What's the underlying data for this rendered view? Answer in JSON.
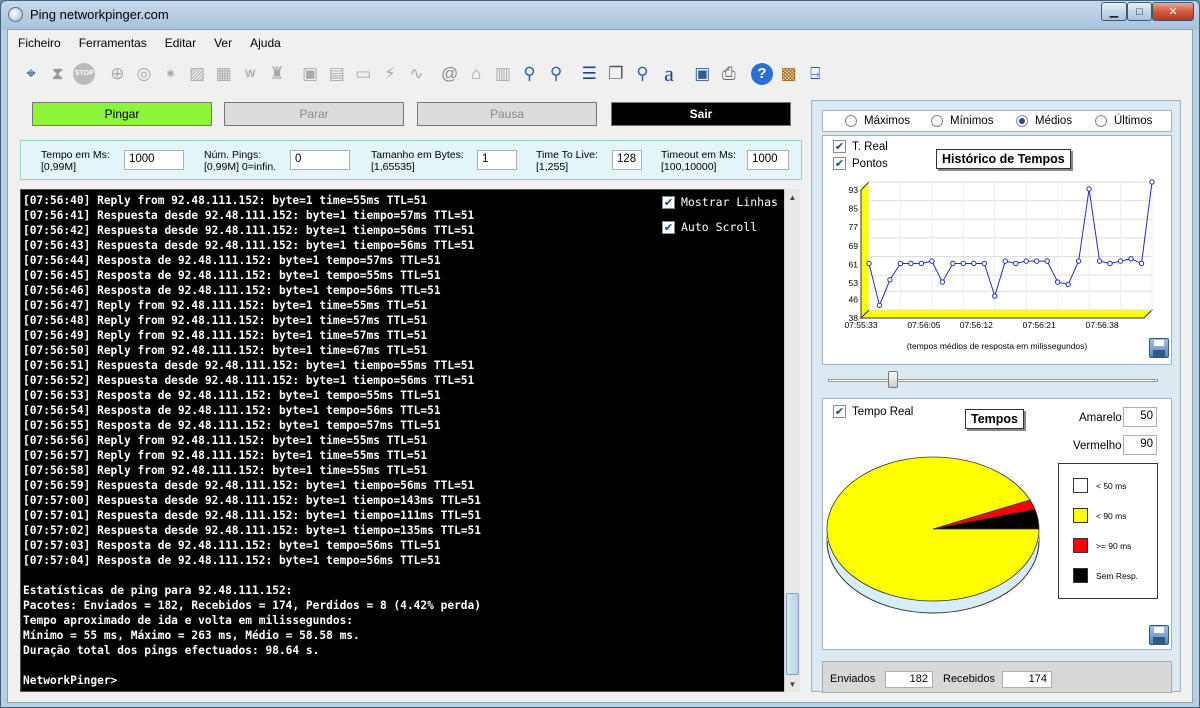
{
  "window": {
    "title": "Ping networkpinger.com",
    "minimize": "▁",
    "maximize": "□",
    "close": "✕"
  },
  "menu": [
    "Ficheiro",
    "Ferramentas",
    "Editar",
    "Ver",
    "Ajuda"
  ],
  "toolbar_icons": [
    "crosshair-icon",
    "hourglass-icon",
    "stop-icon",
    "target-icon",
    "magnifier-icon",
    "whois-icon",
    "traceroute-icon",
    "grid-icon",
    "wmi-icon",
    "castle-icon",
    "computers-icon",
    "monitor-scan-icon",
    "monitor-icon",
    "plug-icon",
    "cable-icon",
    "at-icon",
    "bank-icon",
    "printer-net-icon",
    "search-key-icon",
    "search-key2-icon",
    "list-icon",
    "copy-icon",
    "search-key3-icon",
    "font-icon",
    "save-icon",
    "print-icon",
    "help-icon",
    "treasure-icon",
    "exit-door-icon"
  ],
  "buttons": {
    "ping": "Pingar",
    "stop": "Parar",
    "pause": "Pausa",
    "exit": "Sair"
  },
  "params": {
    "tempo_label": "Tempo em Ms:",
    "tempo_range": "[0,99M]",
    "tempo_value": "1000",
    "num_label": "Núm. Pings:",
    "num_range": "[0,99M] 0=infin.",
    "num_value": "0",
    "size_label": "Tamanho em Bytes:",
    "size_range": "[1,65535]",
    "size_value": "1",
    "ttl_label": "Time To Live:",
    "ttl_range": "[1,255]",
    "ttl_value": "128",
    "timeout_label": "Timeout em Ms:",
    "timeout_range": "[100,10000]",
    "timeout_value": "1000"
  },
  "console": {
    "lines": [
      "[07:56:40] Reply from 92.48.111.152: byte=1 time=55ms TTL=51",
      "[07:56:41] Respuesta desde 92.48.111.152: byte=1 tiempo=57ms TTL=51",
      "[07:56:42] Respuesta desde 92.48.111.152: byte=1 tiempo=56ms TTL=51",
      "[07:56:43] Respuesta desde 92.48.111.152: byte=1 tiempo=56ms TTL=51",
      "[07:56:44] Resposta de 92.48.111.152: byte=1 tempo=57ms TTL=51",
      "[07:56:45] Resposta de 92.48.111.152: byte=1 tempo=55ms TTL=51",
      "[07:56:46] Resposta de 92.48.111.152: byte=1 tempo=56ms TTL=51",
      "[07:56:47] Reply from 92.48.111.152: byte=1 time=55ms TTL=51",
      "[07:56:48] Reply from 92.48.111.152: byte=1 time=57ms TTL=51",
      "[07:56:49] Reply from 92.48.111.152: byte=1 time=57ms TTL=51",
      "[07:56:50] Reply from 92.48.111.152: byte=1 time=67ms TTL=51",
      "[07:56:51] Respuesta desde 92.48.111.152: byte=1 tiempo=55ms TTL=51",
      "[07:56:52] Respuesta desde 92.48.111.152: byte=1 tiempo=56ms TTL=51",
      "[07:56:53] Resposta de 92.48.111.152: byte=1 tempo=55ms TTL=51",
      "[07:56:54] Resposta de 92.48.111.152: byte=1 tempo=56ms TTL=51",
      "[07:56:55] Resposta de 92.48.111.152: byte=1 tempo=57ms TTL=51",
      "[07:56:56] Reply from 92.48.111.152: byte=1 time=55ms TTL=51",
      "[07:56:57] Reply from 92.48.111.152: byte=1 time=55ms TTL=51",
      "[07:56:58] Reply from 92.48.111.152: byte=1 time=55ms TTL=51",
      "[07:56:59] Respuesta desde 92.48.111.152: byte=1 tiempo=56ms TTL=51",
      "[07:57:00] Respuesta desde 92.48.111.152: byte=1 tiempo=143ms TTL=51",
      "[07:57:01] Respuesta desde 92.48.111.152: byte=1 tiempo=111ms TTL=51",
      "[07:57:02] Respuesta desde 92.48.111.152: byte=1 tiempo=135ms TTL=51",
      "[07:57:03] Resposta de 92.48.111.152: byte=1 tempo=56ms TTL=51",
      "[07:57:04] Resposta de 92.48.111.152: byte=1 tempo=56ms TTL=51",
      "",
      "Estatísticas de ping para 92.48.111.152:",
      "Pacotes: Enviados = 182, Recebidos = 174, Perdidos = 8 (4.42% perda)",
      "Tempo aproximado de ida e volta em milissegundos:",
      "Mínimo = 55 ms, Máximo = 263 ms, Médio = 58.58 ms.",
      "Duração total dos pings efectuados: 98.64 s.",
      "",
      "NetworkPinger>"
    ],
    "show_lines": "Mostrar Linhas",
    "auto_scroll": "Auto Scroll"
  },
  "stats_mode": {
    "options": [
      "Máximos",
      "Mínimos",
      "Médios",
      "Últimos"
    ],
    "selected": "Médios"
  },
  "history": {
    "title": "Histórico de Tempos",
    "t_real": "T. Real",
    "pontos": "Pontos",
    "caption": "(tempos médios de resposta em milissegundos)",
    "y_ticks": [
      "93",
      "85",
      "77",
      "69",
      "61",
      "53",
      "46",
      "38"
    ],
    "x_ticks": [
      "07:55:33",
      "07:56:05",
      "07:56:12",
      "07:56:21",
      "07:56:38"
    ]
  },
  "chart_data": [
    {
      "type": "line",
      "title": "Histórico de Tempos",
      "xlabel": "(tempos médios de resposta em milissegundos)",
      "ylim": [
        38,
        93
      ],
      "x_tick_labels": [
        "07:55:33",
        "07:56:05",
        "07:56:12",
        "07:56:21",
        "07:56:38"
      ],
      "values": [
        58,
        40,
        51,
        58,
        58,
        58,
        59,
        50,
        58,
        58,
        58,
        58,
        44,
        59,
        58,
        59,
        59,
        59,
        50,
        49,
        59,
        90,
        59,
        58,
        59,
        60,
        58,
        94
      ],
      "color": "#1f2fbf"
    },
    {
      "type": "pie",
      "title": "Tempos",
      "labels": [
        "< 50 ms",
        "< 90 ms",
        ">= 90 ms",
        "Sem Resp."
      ],
      "values": [
        0,
        93.4,
        2.2,
        4.4
      ],
      "colors": [
        "#ffffff",
        "#ffff00",
        "#ff0000",
        "#000000"
      ]
    }
  ],
  "tempos": {
    "title": "Tempos",
    "tempo_real": "Tempo Real",
    "amarelo_label": "Amarelo",
    "amarelo_value": "50",
    "vermelho_label": "Vermelho",
    "vermelho_value": "90",
    "legend": [
      "< 50 ms",
      "< 90 ms",
      ">= 90 ms",
      "Sem Resp."
    ]
  },
  "bottom": {
    "sent_label": "Enviados",
    "sent_value": "182",
    "recv_label": "Recebidos",
    "recv_value": "174"
  },
  "colors": {
    "ping_btn": "#8cf53a",
    "exit_btn": "#000000",
    "console_bg": "#000000",
    "line": "#1f2fbf",
    "yellow": "#ffff00"
  }
}
